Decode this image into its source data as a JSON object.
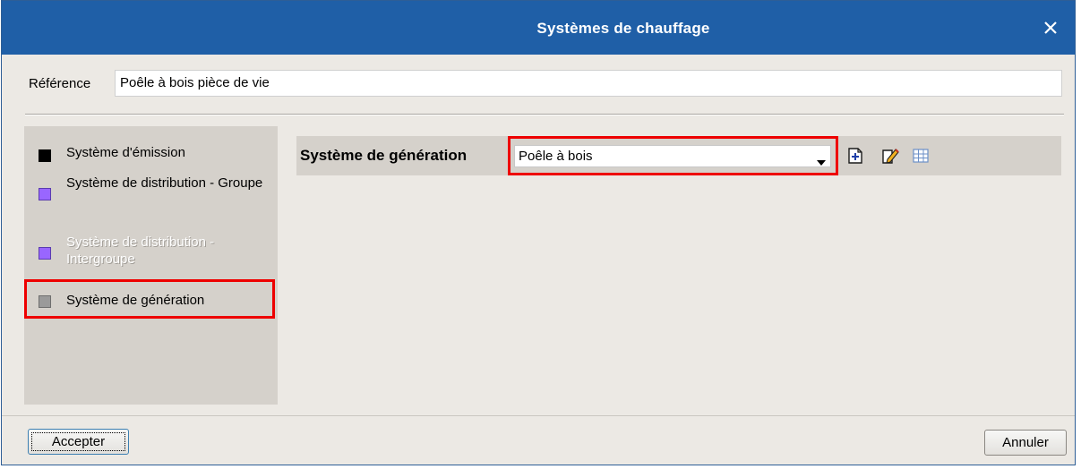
{
  "window": {
    "title": "Systèmes de chauffage",
    "close_icon": "close-icon",
    "title_bar_color": "#1f5fa7"
  },
  "reference": {
    "label": "Référence",
    "value": "Poêle à bois pièce de vie"
  },
  "sidebar": {
    "items": [
      {
        "label": "Système d'émission",
        "color": "#000000",
        "enabled": true,
        "selected": false
      },
      {
        "label": "Système de distribution - Groupe",
        "color": "#9966ff",
        "enabled": true,
        "selected": false
      },
      {
        "label": "Système de distribution - Intergroupe",
        "color": "#9966ff",
        "enabled": false,
        "selected": false
      },
      {
        "label": "Système de génération",
        "color": "#9a9a9a",
        "enabled": true,
        "selected": true
      }
    ]
  },
  "main": {
    "generation_label": "Système de génération",
    "generation_select": {
      "value": "Poêle à bois"
    },
    "tools": [
      {
        "icon": "add-icon"
      },
      {
        "icon": "edit-icon"
      },
      {
        "icon": "table-icon"
      }
    ]
  },
  "footer": {
    "accept_label": "Accepter",
    "cancel_label": "Annuler"
  },
  "highlight_color": "#ee0000"
}
